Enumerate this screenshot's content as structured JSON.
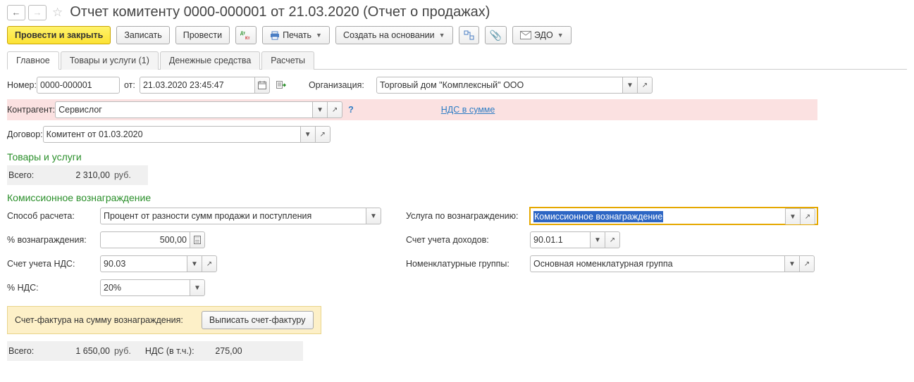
{
  "header": {
    "title": "Отчет комитенту 0000-000001 от 21.03.2020 (Отчет о продажах)"
  },
  "toolbar": {
    "post_close": "Провести и закрыть",
    "save": "Записать",
    "post": "Провести",
    "print": "Печать",
    "create_on_basis": "Создать на основании",
    "edo": "ЭДО"
  },
  "tabs": [
    {
      "label": "Главное"
    },
    {
      "label": "Товары и услуги (1)"
    },
    {
      "label": "Денежные средства"
    },
    {
      "label": "Расчеты"
    }
  ],
  "form": {
    "number_label": "Номер:",
    "number": "0000-000001",
    "from_label": "от:",
    "date": "21.03.2020 23:45:47",
    "org_label": "Организация:",
    "org": "Торговый дом \"Комплексный\" ООО",
    "counterparty_label": "Контрагент:",
    "counterparty": "Сервислог",
    "vat_link": "НДС в сумме",
    "contract_label": "Договор:",
    "contract": "Комитент от 01.03.2020"
  },
  "goods": {
    "title": "Товары и услуги",
    "total_label": "Всего:",
    "total_value": "2 310,00",
    "currency": "руб."
  },
  "commission": {
    "title": "Комиссионное вознаграждение",
    "calc_method_label": "Способ расчета:",
    "calc_method": "Процент от разности сумм продажи и поступления",
    "percent_label": "% вознаграждения:",
    "percent": "500,00",
    "vat_account_label": "Счет учета НДС:",
    "vat_account": "90.03",
    "vat_percent_label": "% НДС:",
    "vat_percent": "20%",
    "service_label": "Услуга по вознаграждению:",
    "service": "Комиссионное вознаграждение",
    "income_account_label": "Счет учета доходов:",
    "income_account": "90.01.1",
    "nomen_label": "Номенклатурные группы:",
    "nomen": "Основная номенклатурная группа",
    "invoice_label": "Счет-фактура на сумму вознаграждения:",
    "write_invoice_btn": "Выписать счет-фактуру"
  },
  "totals": {
    "total_label": "Всего:",
    "total_value": "1 650,00",
    "currency": "руб.",
    "vat_label": "НДС (в т.ч.):",
    "vat_value": "275,00"
  }
}
